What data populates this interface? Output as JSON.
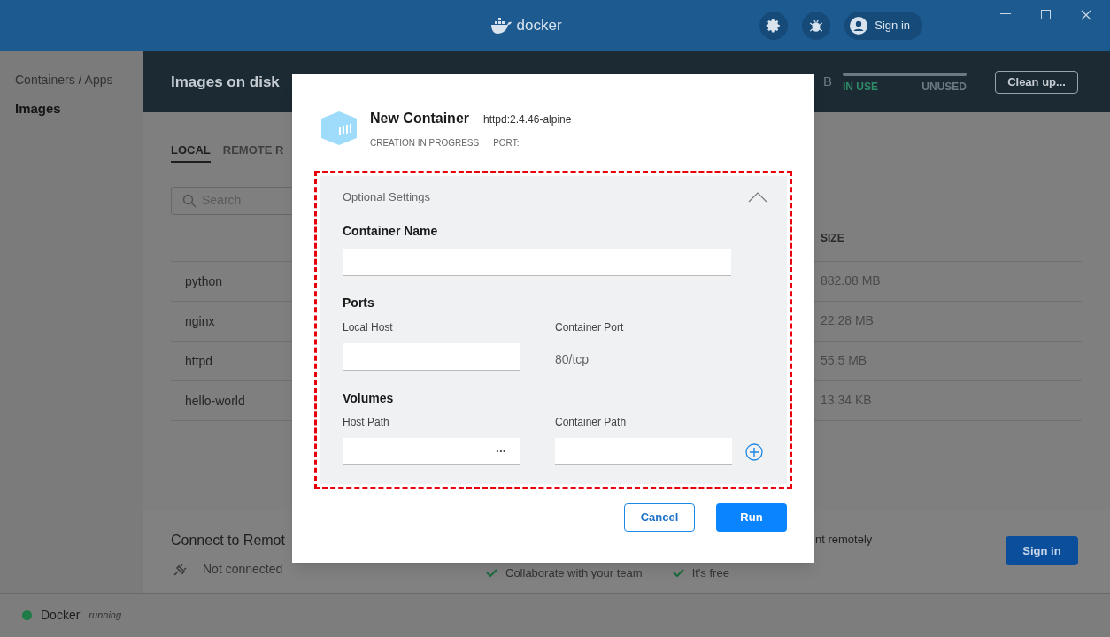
{
  "titlebar": {
    "logo_text": "docker",
    "sign_in": "Sign in"
  },
  "sidebar": {
    "items": [
      {
        "label": "Containers / Apps",
        "selected": false
      },
      {
        "label": "Images",
        "selected": true
      }
    ]
  },
  "header": {
    "title": "Images on disk",
    "size_fragment": "B",
    "in_use": "IN USE",
    "unused": "UNUSED",
    "clean_up": "Clean up..."
  },
  "tabs": [
    {
      "label": "LOCAL",
      "selected": true
    },
    {
      "label": "REMOTE R",
      "selected": false
    }
  ],
  "search": {
    "placeholder": "Search"
  },
  "table": {
    "columns": [
      "SIZE"
    ],
    "rows": [
      {
        "name": "python",
        "size": "882.08 MB"
      },
      {
        "name": "nginx",
        "size": "22.28 MB"
      },
      {
        "name": "httpd",
        "size": "55.5 MB"
      },
      {
        "name": "hello-world",
        "size": "13.34 KB"
      }
    ]
  },
  "remote": {
    "title": "Connect to Remot",
    "status": "Not connected",
    "features": [
      "Collaborate with your team",
      "It's free"
    ],
    "fragment": "nt remotely",
    "sign_in": "Sign in"
  },
  "status_bar": {
    "name": "Docker",
    "state": "running",
    "color": "#1e7a46"
  },
  "dialog": {
    "title": "New Container",
    "image": "httpd:2.4.46-alpine",
    "status": "CREATION IN PROGRESS",
    "port_label": "PORT:",
    "section": "Optional Settings",
    "expanded": true,
    "container_name_label": "Container Name",
    "ports_heading": "Ports",
    "local_host_label": "Local Host",
    "container_port_label": "Container Port",
    "container_port_value": "80/tcp",
    "volumes_heading": "Volumes",
    "host_path_label": "Host Path",
    "container_path_label": "Container Path",
    "browse": "•••",
    "cancel": "Cancel",
    "run": "Run"
  }
}
